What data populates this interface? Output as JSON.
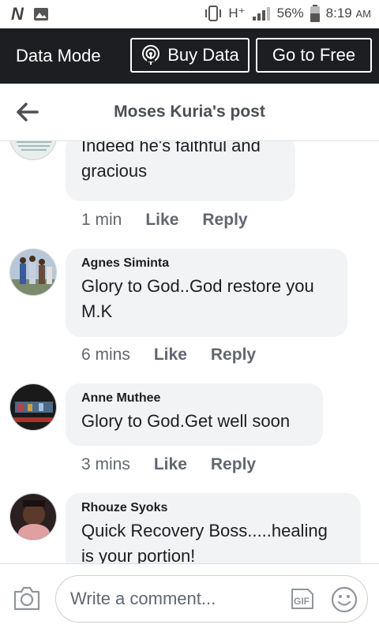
{
  "status_bar": {
    "signal_label": "H⁺",
    "battery": "56%",
    "time": "8:19",
    "ampm": "AM"
  },
  "data_mode": {
    "label": "Data Mode",
    "buy_label": "Buy Data",
    "free_label": "Go to Free"
  },
  "header": {
    "title": "Moses Kuria's post"
  },
  "comments": [
    {
      "author": "",
      "text_lines": [
        "Indeed he's faithful and",
        "gracious"
      ],
      "time": "1 min",
      "like": "Like",
      "reply": "Reply"
    },
    {
      "author": "Agnes Siminta",
      "text_lines": [
        "Glory to God..God restore you",
        "M.K"
      ],
      "time": "6 mins",
      "like": "Like",
      "reply": "Reply"
    },
    {
      "author": "Anne Muthee",
      "text_lines": [
        "Glory to God.Get well soon"
      ],
      "time": "3 mins",
      "like": "Like",
      "reply": "Reply"
    },
    {
      "author": "Rhouze Syoks",
      "text_lines": [
        "Quick Recovery Boss.....healing",
        "is your portion!"
      ],
      "time": "",
      "like": "",
      "reply": ""
    }
  ],
  "composer": {
    "placeholder": "Write a comment...",
    "gif_label": "GIF"
  },
  "icons": [
    "n-icon",
    "image-icon",
    "vibrate-icon",
    "signal-icon",
    "battery-icon",
    "broadcast-icon",
    "back-arrow-icon",
    "camera-icon",
    "gif-icon",
    "emoji-icon"
  ],
  "colors": {
    "data_bar": "#1c1e21",
    "bubble": "#f2f3f5",
    "meta_text": "#606770"
  }
}
